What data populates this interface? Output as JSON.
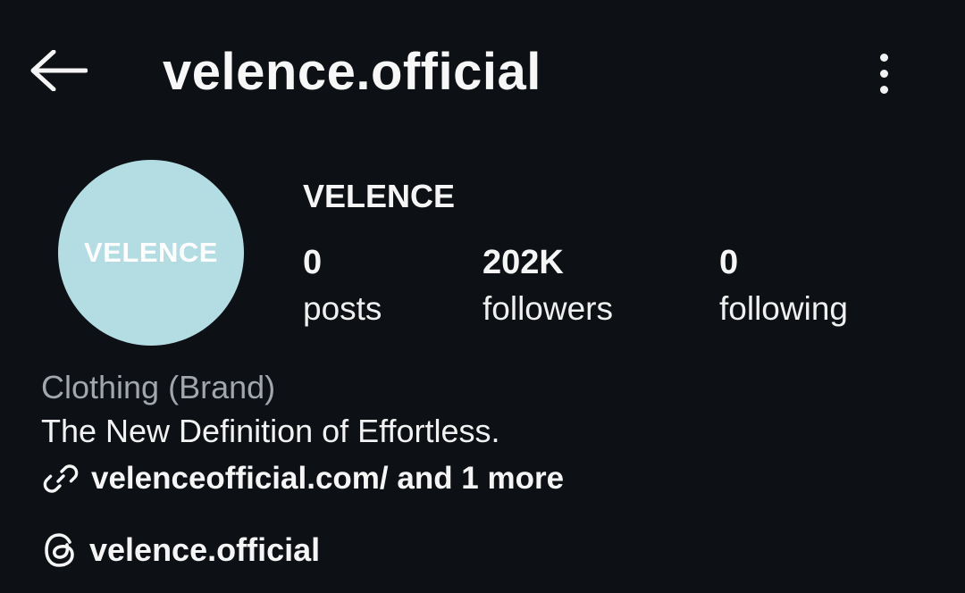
{
  "header": {
    "back_icon": "arrow-left-icon",
    "username": "velence.official",
    "more_icon": "more-vertical-icon"
  },
  "profile": {
    "avatar_logo_text": "VELENCE",
    "avatar_color": "#b3dde3",
    "display_name": "VELENCE",
    "stats": {
      "posts": {
        "value": "0",
        "label": "posts"
      },
      "followers": {
        "value": "202K",
        "label": "followers"
      },
      "following": {
        "value": "0",
        "label": "following"
      }
    }
  },
  "bio": {
    "category": "Clothing (Brand)",
    "text": "The New Definition of Effortless.",
    "link_icon": "link-icon",
    "link": "velenceofficial.com/ and 1 more",
    "threads_icon": "threads-icon",
    "threads_handle": "velence.official"
  },
  "colors": {
    "background": "#0d1015",
    "text": "#f5f5f5",
    "muted_text": "#a2a6ad"
  }
}
